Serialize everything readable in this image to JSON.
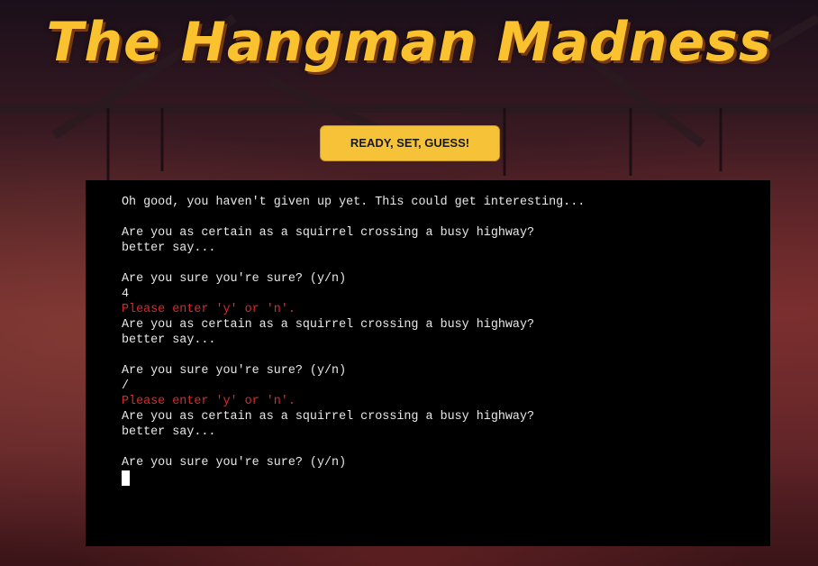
{
  "header": {
    "title": "The Hangman Madness"
  },
  "controls": {
    "run_button_label": "READY, SET, GUESS!"
  },
  "terminal": {
    "lines": [
      {
        "text": "Oh good, you haven't given up yet. This could get interesting...",
        "kind": "normal"
      },
      {
        "text": "",
        "kind": "normal"
      },
      {
        "text": "Are you as certain as a squirrel crossing a busy highway?",
        "kind": "normal"
      },
      {
        "text": "better say...",
        "kind": "normal"
      },
      {
        "text": "",
        "kind": "normal"
      },
      {
        "text": "Are you sure you're sure? (y/n)",
        "kind": "normal"
      },
      {
        "text": "4",
        "kind": "normal"
      },
      {
        "text": "Please enter 'y' or 'n'.",
        "kind": "error"
      },
      {
        "text": "Are you as certain as a squirrel crossing a busy highway?",
        "kind": "normal"
      },
      {
        "text": "better say...",
        "kind": "normal"
      },
      {
        "text": "",
        "kind": "normal"
      },
      {
        "text": "Are you sure you're sure? (y/n)",
        "kind": "normal"
      },
      {
        "text": "/",
        "kind": "normal"
      },
      {
        "text": "Please enter 'y' or 'n'.",
        "kind": "error"
      },
      {
        "text": "Are you as certain as a squirrel crossing a busy highway?",
        "kind": "normal"
      },
      {
        "text": "better say...",
        "kind": "normal"
      },
      {
        "text": "",
        "kind": "normal"
      },
      {
        "text": "Are you sure you're sure? (y/n)",
        "kind": "normal"
      }
    ]
  },
  "colors": {
    "title": "#f9c22e",
    "button": "#f6c237",
    "error_text": "#e0282a",
    "terminal_bg": "#000000"
  }
}
